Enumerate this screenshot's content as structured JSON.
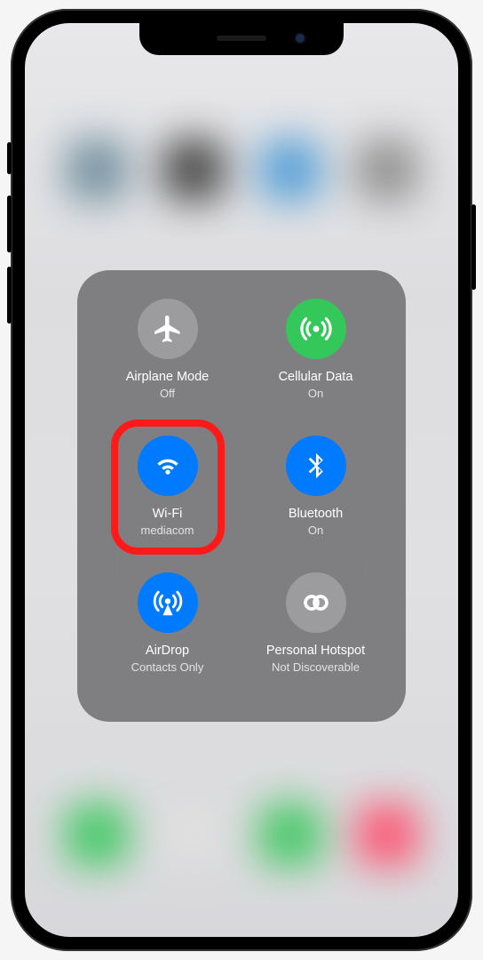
{
  "tiles": {
    "airplane": {
      "label": "Airplane Mode",
      "sublabel": "Off"
    },
    "cellular": {
      "label": "Cellular Data",
      "sublabel": "On"
    },
    "wifi": {
      "label": "Wi-Fi",
      "sublabel": "mediacom"
    },
    "bluetooth": {
      "label": "Bluetooth",
      "sublabel": "On"
    },
    "airdrop": {
      "label": "AirDrop",
      "sublabel": "Contacts Only"
    },
    "hotspot": {
      "label": "Personal Hotspot",
      "sublabel": "Not Discoverable"
    }
  }
}
